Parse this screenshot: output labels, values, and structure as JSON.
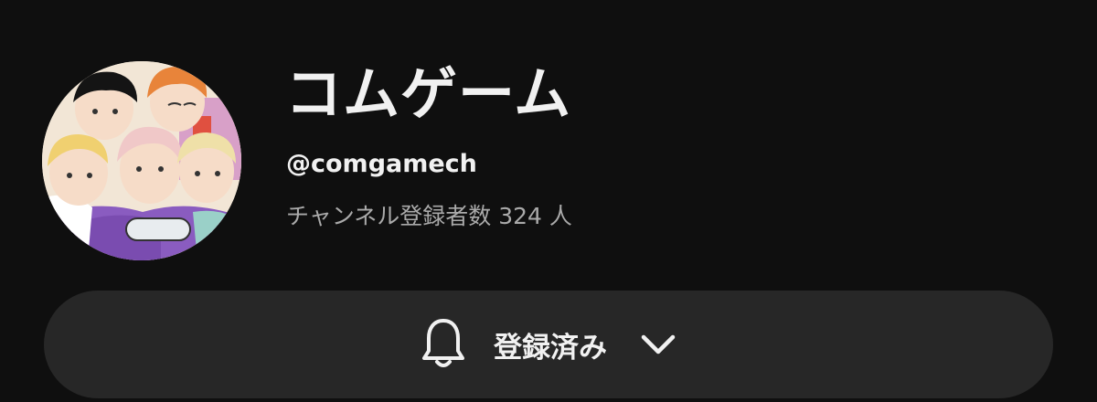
{
  "channel": {
    "name": "コムゲーム",
    "handle": "@comgamech",
    "subscribers": "チャンネル登録者数 324 人"
  },
  "subscribe_button": {
    "label": "登録済み",
    "icon": "bell-icon",
    "dropdown_icon": "chevron-down-icon"
  },
  "colors": {
    "background": "#0f0f0f",
    "button_bg": "#272727",
    "primary_text": "#f1f1f1",
    "secondary_text": "#aaaaaa"
  }
}
